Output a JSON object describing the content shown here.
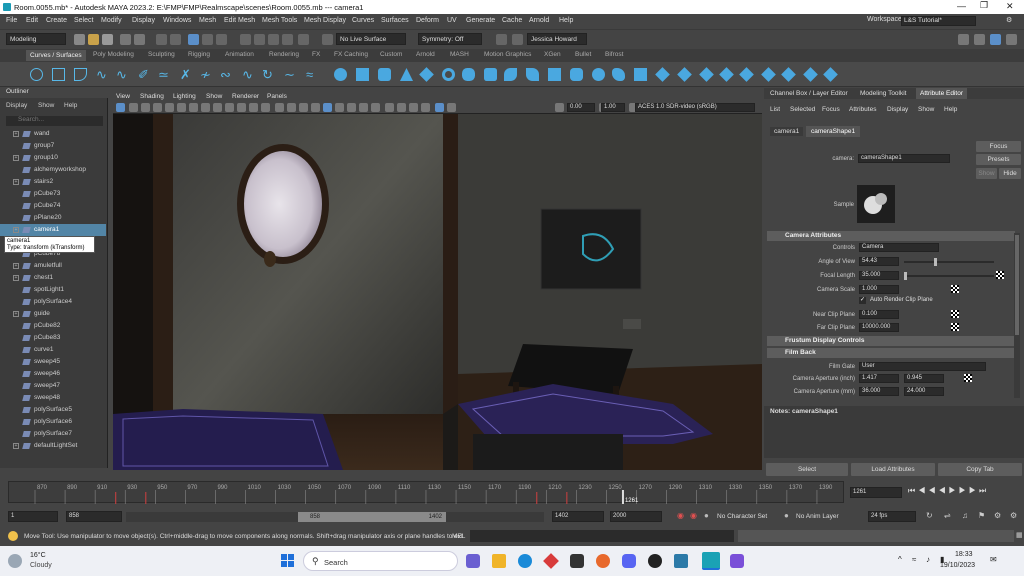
{
  "titlebar": {
    "title": "Room.0055.mb* - Autodesk MAYA 2023.2: E:\\FMP\\FMP\\Realmscape\\scenes\\Room.0055.mb   ---   camera1"
  },
  "menubar": [
    "File",
    "Edit",
    "Create",
    "Select",
    "Modify",
    "Display",
    "Windows",
    "Mesh",
    "Edit Mesh",
    "Mesh Tools",
    "Mesh Display",
    "Curves",
    "Surfaces",
    "Deform",
    "UV",
    "Generate",
    "Cache",
    "Arnold",
    "Help"
  ],
  "workspace": {
    "label": "Workspace:",
    "value": "L&S Tutorial*"
  },
  "statusline": {
    "mode": "Modeling",
    "live": "No Live Surface",
    "symmetry": "Symmetry: Off",
    "user": "Jessica Howard"
  },
  "shelf_tabs": [
    "Curves / Surfaces",
    "Poly Modeling",
    "Sculpting",
    "Rigging",
    "Animation",
    "Rendering",
    "FX",
    "FX Caching",
    "Custom",
    "Arnold",
    "MASH",
    "Motion Graphics",
    "XGen",
    "Bullet",
    "Bifrost"
  ],
  "outliner": {
    "title": "Outliner",
    "menu": [
      "Display",
      "Show",
      "Help"
    ],
    "search_placeholder": "Search...",
    "items": [
      {
        "label": "wand",
        "expand": "+"
      },
      {
        "label": "group7",
        "expand": ""
      },
      {
        "label": "group10",
        "expand": "+"
      },
      {
        "label": "alchemyworkshop",
        "expand": ""
      },
      {
        "label": "stairs2",
        "expand": "+"
      },
      {
        "label": "pCube73",
        "expand": ""
      },
      {
        "label": "pCube74",
        "expand": ""
      },
      {
        "label": "pPlane20",
        "expand": ""
      },
      {
        "label": "camera1",
        "expand": "+",
        "selected": true
      },
      {
        "label": "pPlane22",
        "expand": ""
      },
      {
        "label": "pCube78",
        "expand": ""
      },
      {
        "label": "amuletfull",
        "expand": "+"
      },
      {
        "label": "chest1",
        "expand": "+"
      },
      {
        "label": "spotLight1",
        "expand": ""
      },
      {
        "label": "polySurface4",
        "expand": ""
      },
      {
        "label": "guide",
        "expand": "+"
      },
      {
        "label": "pCube82",
        "expand": ""
      },
      {
        "label": "pCube83",
        "expand": ""
      },
      {
        "label": "curve1",
        "expand": ""
      },
      {
        "label": "sweep45",
        "expand": ""
      },
      {
        "label": "sweep46",
        "expand": ""
      },
      {
        "label": "sweep47",
        "expand": ""
      },
      {
        "label": "sweep48",
        "expand": ""
      },
      {
        "label": "polySurface5",
        "expand": ""
      },
      {
        "label": "polySurface6",
        "expand": ""
      },
      {
        "label": "polySurface7",
        "expand": ""
      },
      {
        "label": "defaultLightSet",
        "expand": "+"
      }
    ],
    "tooltip": {
      "name": "camera1",
      "type": "Type: transform (kTransform)"
    }
  },
  "viewport": {
    "menu": [
      "View",
      "Shading",
      "Lighting",
      "Show",
      "Renderer",
      "Panels"
    ],
    "exposure": "0.00",
    "gamma": "1.00",
    "colorspace": "ACES 1.0 SDR-video (sRGB)"
  },
  "attr": {
    "tabs": [
      "Channel Box / Layer Editor",
      "Modeling Toolkit",
      "Attribute Editor"
    ],
    "menu": [
      "List",
      "Selected",
      "Focus",
      "Attributes",
      "Display",
      "Show",
      "Help"
    ],
    "node_tabs": [
      "camera1",
      "cameraShape1"
    ],
    "camera_label": "camera:",
    "camera_value": "cameraShape1",
    "focus": "Focus",
    "presets": "Presets",
    "show": "Show",
    "hide": "Hide",
    "sample": "Sample",
    "sections": {
      "camera_attrs": "Camera Attributes",
      "frustum": "Frustum Display Controls",
      "film_back": "Film Back"
    },
    "fields": {
      "controls_label": "Controls",
      "controls_value": "Camera",
      "aov_label": "Angle of View",
      "aov_value": "54.43",
      "focal_label": "Focal Length",
      "focal_value": "35.000",
      "scale_label": "Camera Scale",
      "scale_value": "1.000",
      "auto_clip": "Auto Render Clip Plane",
      "near_label": "Near Clip Plane",
      "near_value": "0.100",
      "far_label": "Far Clip Plane",
      "far_value": "10000.000",
      "gate_label": "Film Gate",
      "gate_value": "User",
      "ap_inch_label": "Camera Aperture (inch)",
      "ap_inch_x": "1.417",
      "ap_inch_y": "0.945",
      "ap_mm_label": "Camera Aperture (mm)",
      "ap_mm_x": "36.000",
      "ap_mm_y": "24.000"
    },
    "notes": "Notes:  cameraShape1",
    "bottom_buttons": [
      "Select",
      "Load Attributes",
      "Copy Tab"
    ]
  },
  "timeline": {
    "ticks": [
      "870",
      "890",
      "910",
      "930",
      "950",
      "970",
      "990",
      "1010",
      "1030",
      "1050",
      "1070",
      "1090",
      "1110",
      "1130",
      "1150",
      "1170",
      "1190",
      "1210",
      "1230",
      "1250",
      "1270",
      "1290",
      "1310",
      "1330",
      "1350",
      "1370",
      "1390"
    ],
    "current_frame_label": "1261",
    "current_frame_field": "1261",
    "current_frame_index": 1261
  },
  "range": {
    "start": "1",
    "min": "858",
    "slider_start": "858",
    "slider_end": "1402",
    "max": "1402",
    "end": "2000",
    "char_set": "No Character Set",
    "anim_layer": "No Anim Layer",
    "fps": "24 fps"
  },
  "helpline": {
    "text": "Move Tool: Use manipulator to move object(s). Ctrl+middle-drag to move components along normals. Shift+drag manipulator axis or plane handles to ext",
    "mel": "MEL"
  },
  "taskbar": {
    "temp": "16°C",
    "weather": "Cloudy",
    "search": "Search",
    "time": "18:33",
    "date": "19/10/2023"
  }
}
